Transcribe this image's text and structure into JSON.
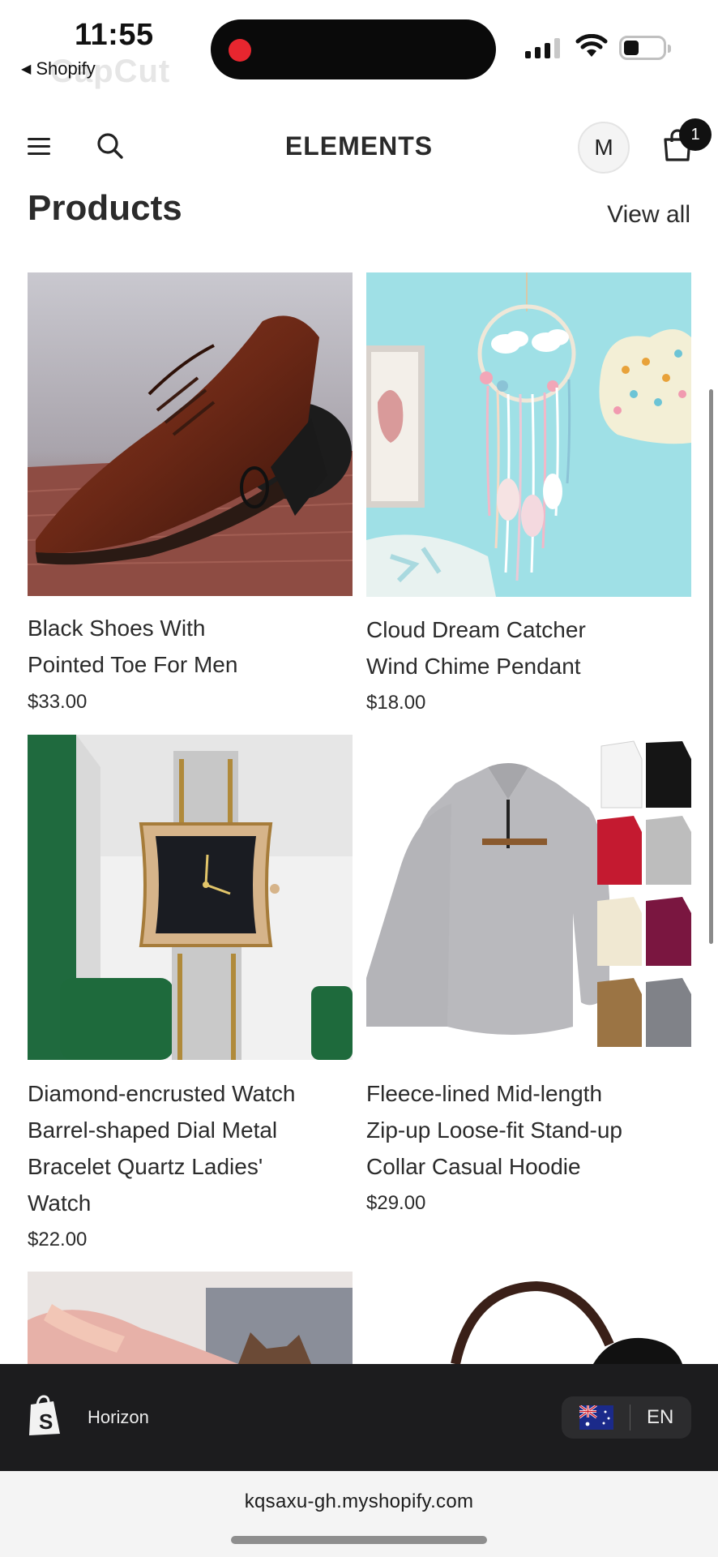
{
  "status_bar": {
    "time": "11:55",
    "back_app": "Shopify",
    "watermark": "CapCut"
  },
  "header": {
    "brand": "ELEMENTS",
    "account_initial": "M",
    "cart_count": "1"
  },
  "section": {
    "title": "Products",
    "view_all": "View all"
  },
  "products": [
    {
      "title": "Black Shoes With Pointed Toe For Men",
      "price": "$33.00"
    },
    {
      "title": "Cloud Dream Catcher Wind Chime Pendant",
      "price": "$18.00"
    },
    {
      "title": "Diamond-encrusted Watch Barrel-shaped Dial Metal Bracelet Quartz Ladies' Watch",
      "price": "$22.00"
    },
    {
      "title": "Fleece-lined Mid-length Zip-up Loose-fit Stand-up Collar Casual Hoodie",
      "price": "$29.00"
    }
  ],
  "preview_bar": {
    "theme": "Horizon",
    "locale": "EN"
  },
  "browser": {
    "url": "kqsaxu-gh.myshopify.com"
  },
  "colors": {
    "accent": "#111111",
    "bar_bg": "#1c1c1e",
    "record": "#e8262f"
  }
}
